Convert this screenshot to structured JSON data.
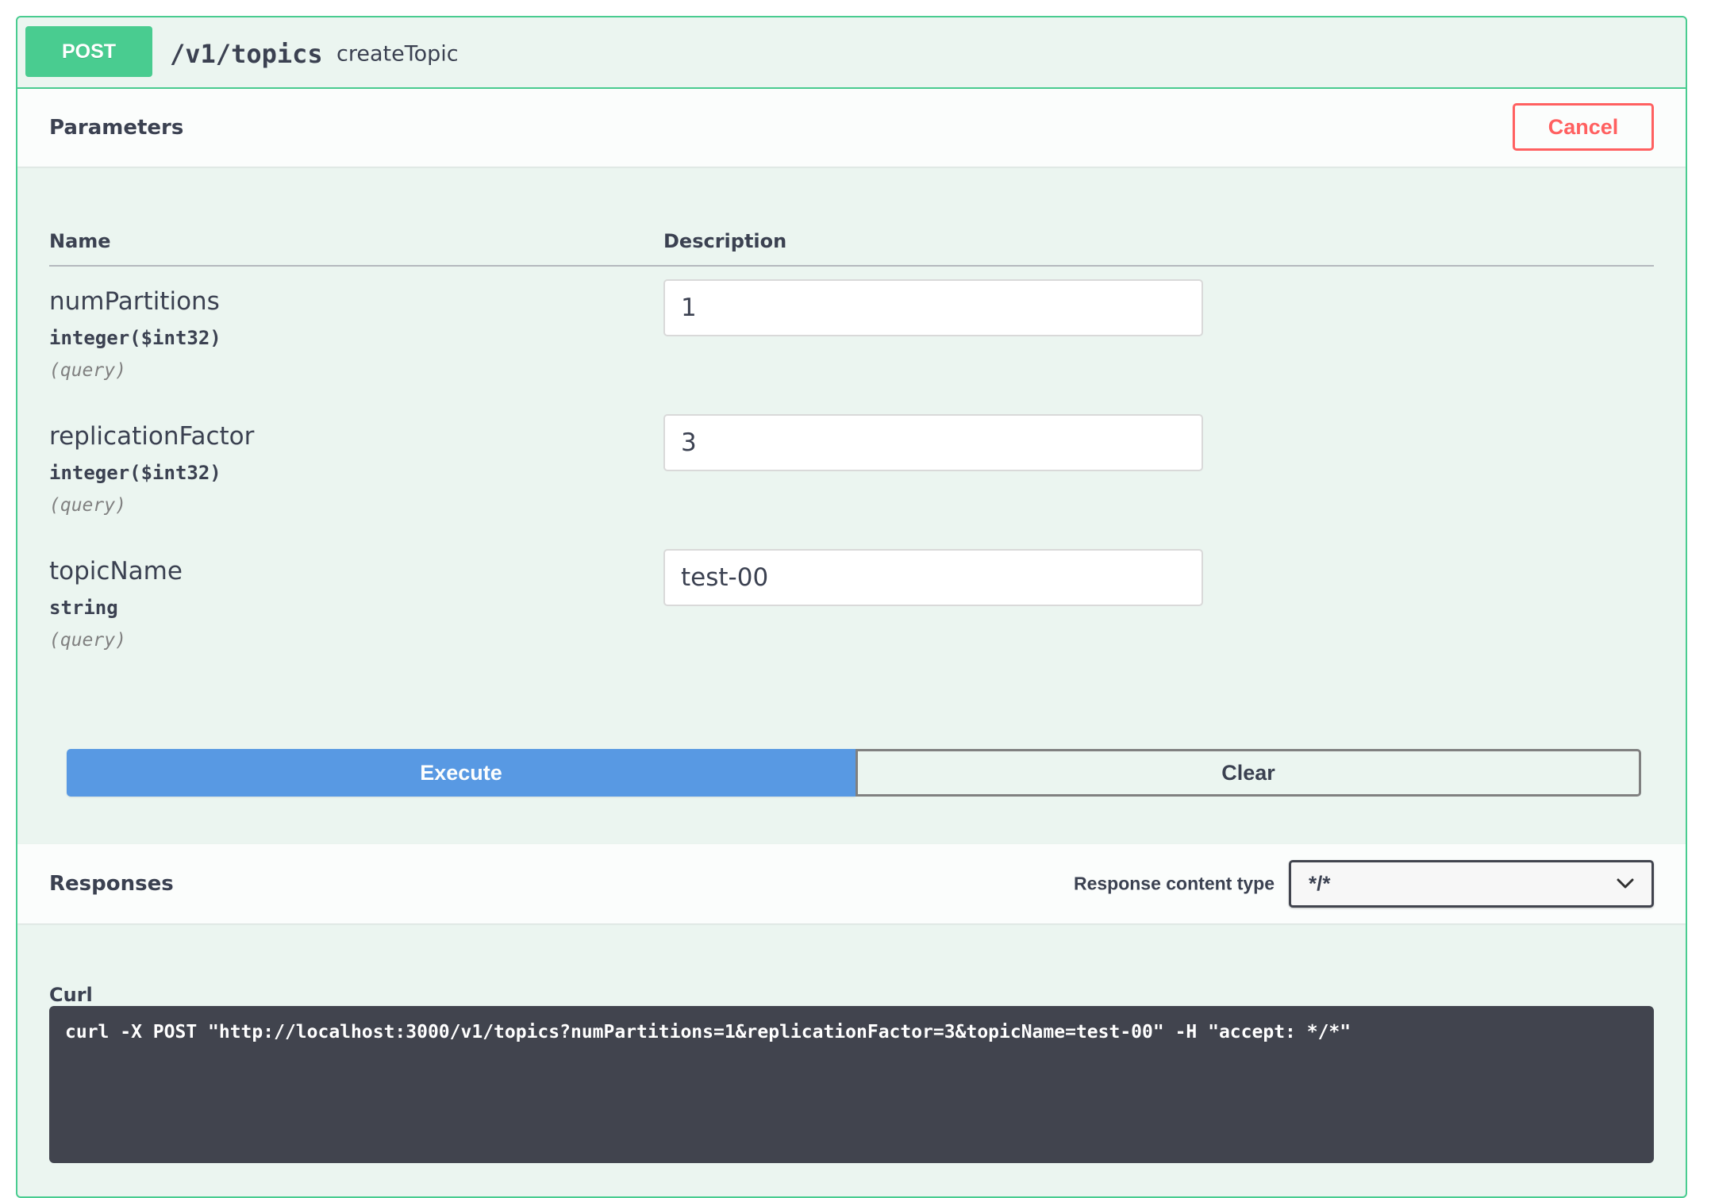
{
  "operation": {
    "method": "POST",
    "path": "/v1/topics",
    "operation_id": "createTopic"
  },
  "parameters_section": {
    "title": "Parameters",
    "cancel_label": "Cancel",
    "columns": {
      "name": "Name",
      "description": "Description"
    },
    "params": [
      {
        "name": "numPartitions",
        "type": "integer($int32)",
        "in": "(query)",
        "value": "1"
      },
      {
        "name": "replicationFactor",
        "type": "integer($int32)",
        "in": "(query)",
        "value": "3"
      },
      {
        "name": "topicName",
        "type": "string",
        "in": "(query)",
        "value": "test-00"
      }
    ]
  },
  "actions": {
    "execute_label": "Execute",
    "clear_label": "Clear"
  },
  "responses_section": {
    "title": "Responses",
    "content_type_label": "Response content type",
    "content_type_value": "*/*"
  },
  "curl": {
    "label": "Curl",
    "command": "curl -X POST \"http://localhost:3000/v1/topics?numPartitions=1&replicationFactor=3&topicName=test-00\" -H \"accept: */*\""
  },
  "colors": {
    "post_green": "#49cc90",
    "block_bg": "#ebf5f0",
    "execute_blue": "#4990e2",
    "cancel_red": "#ff6060",
    "curl_bg": "#41444e"
  }
}
